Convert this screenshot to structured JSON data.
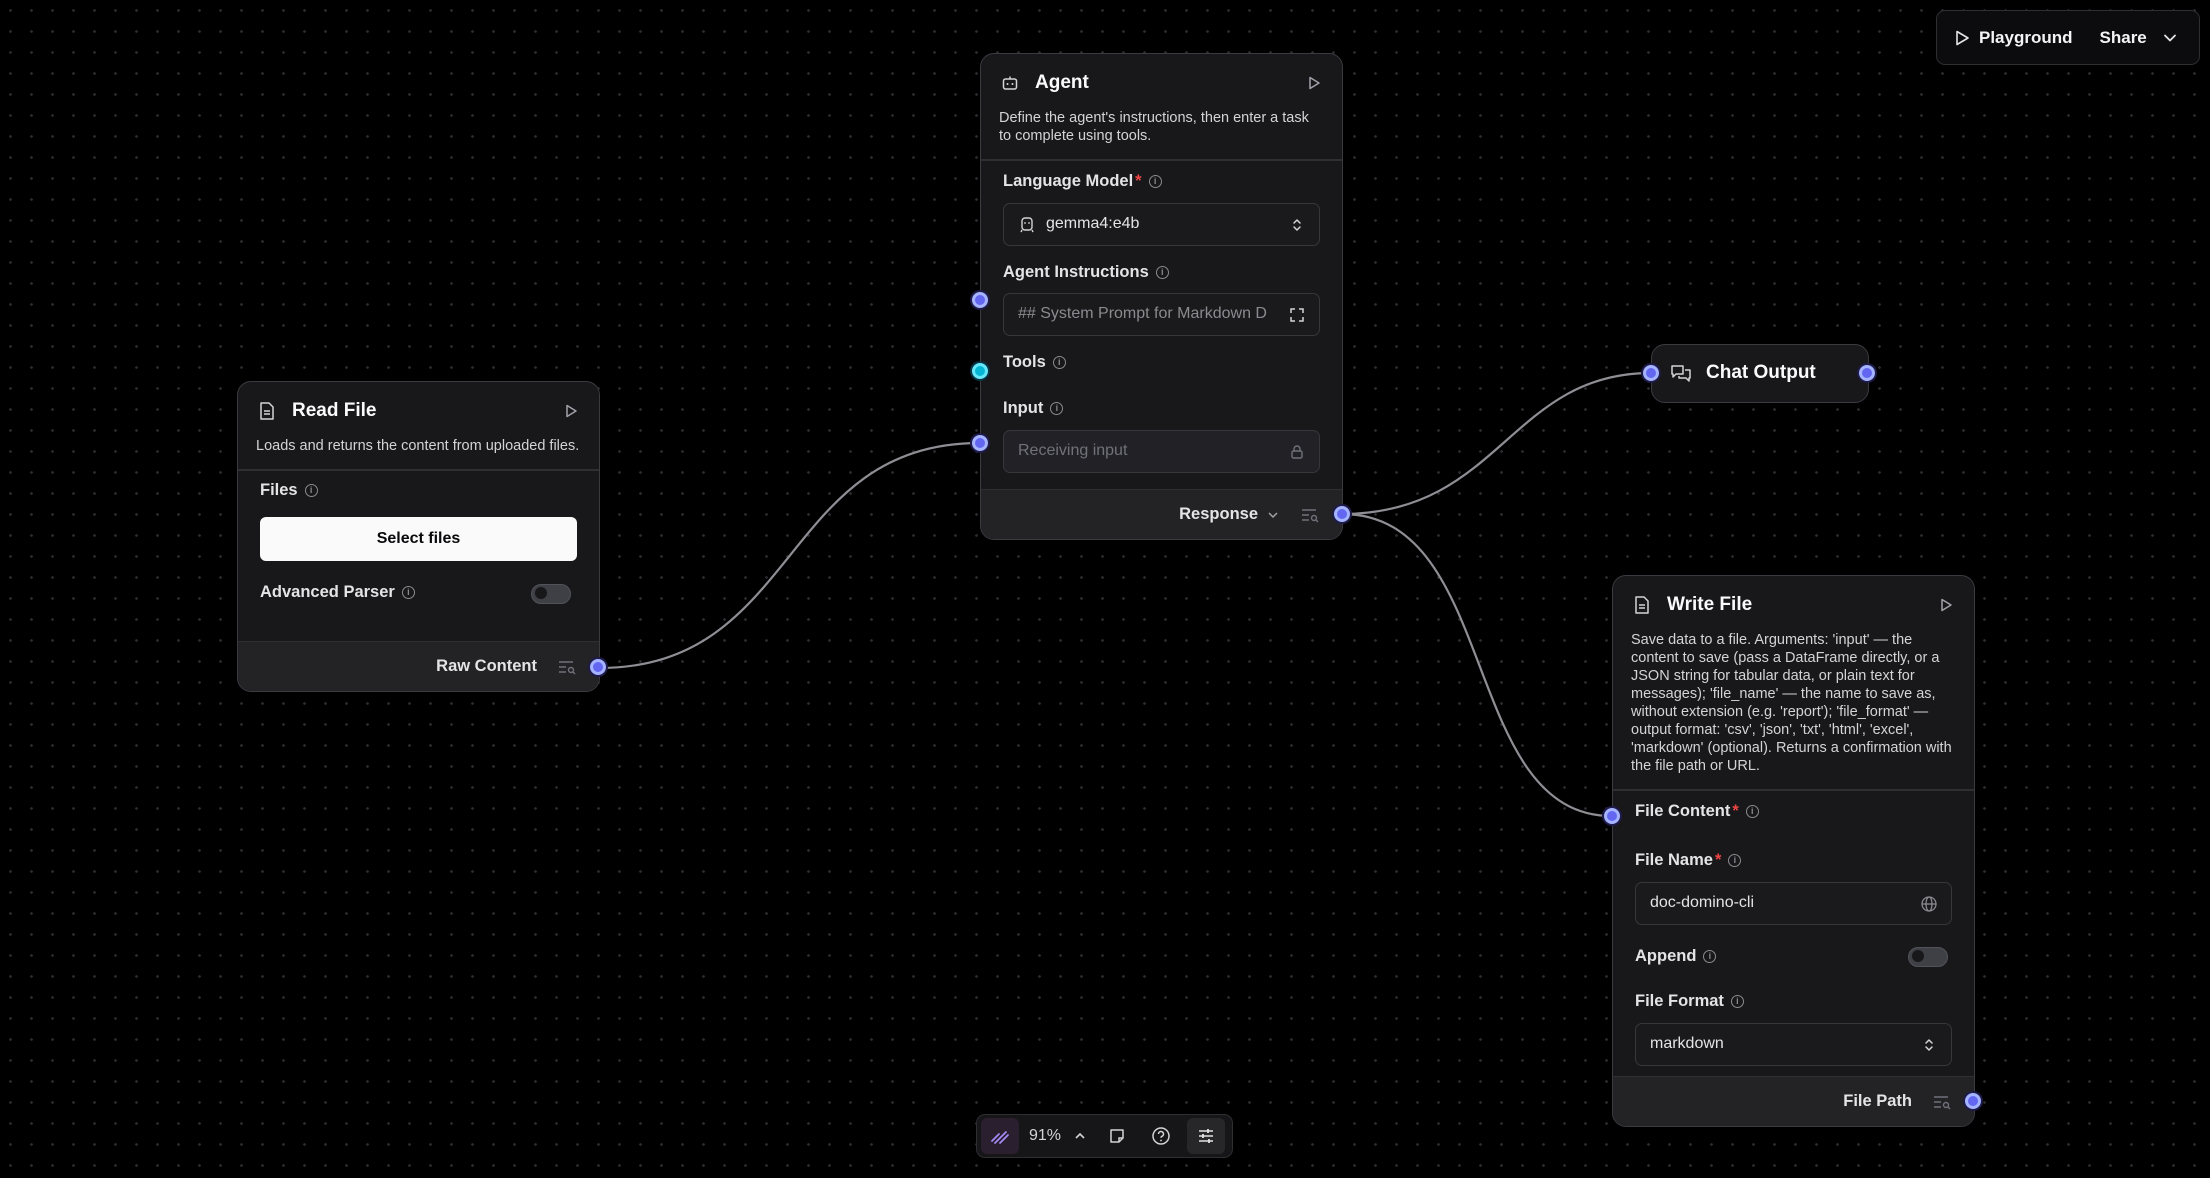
{
  "toolbar": {
    "playground_label": "Playground",
    "share_label": "Share"
  },
  "agent": {
    "title": "Agent",
    "description": "Define the agent's instructions, then enter a task to complete using tools.",
    "language_model_label": "Language Model",
    "language_model_value": "gemma4:e4b",
    "instructions_label": "Agent Instructions",
    "instructions_value": "## System Prompt for Markdown D",
    "tools_label": "Tools",
    "input_label": "Input",
    "input_placeholder": "Receiving input",
    "output_label": "Response"
  },
  "read_file": {
    "title": "Read File",
    "description": "Loads and returns the content from uploaded files.",
    "files_label": "Files",
    "select_files_label": "Select files",
    "advanced_parser_label": "Advanced Parser",
    "advanced_parser_on": false,
    "output_label": "Raw Content"
  },
  "chat_output": {
    "title": "Chat Output"
  },
  "write_file": {
    "title": "Write File",
    "description": "Save data to a file. Arguments: 'input' — the content to save (pass a DataFrame directly, or a JSON string for tabular data, or plain text for messages); 'file_name' — the name to save as, without extension (e.g. 'report'); 'file_format' — output format: 'csv', 'json', 'txt', 'html', 'excel', 'markdown' (optional). Returns a confirmation with the file path or URL.",
    "file_content_label": "File Content",
    "file_name_label": "File Name",
    "file_name_value": "doc-domino-cli",
    "append_label": "Append",
    "append_on": false,
    "file_format_label": "File Format",
    "file_format_value": "markdown",
    "output_label": "File Path"
  },
  "canvas_controls": {
    "zoom": "91%"
  },
  "colors": {
    "handle": "#6366f1",
    "tool_handle": "#06b6d4",
    "background": "#000000",
    "node": "#18181b"
  }
}
